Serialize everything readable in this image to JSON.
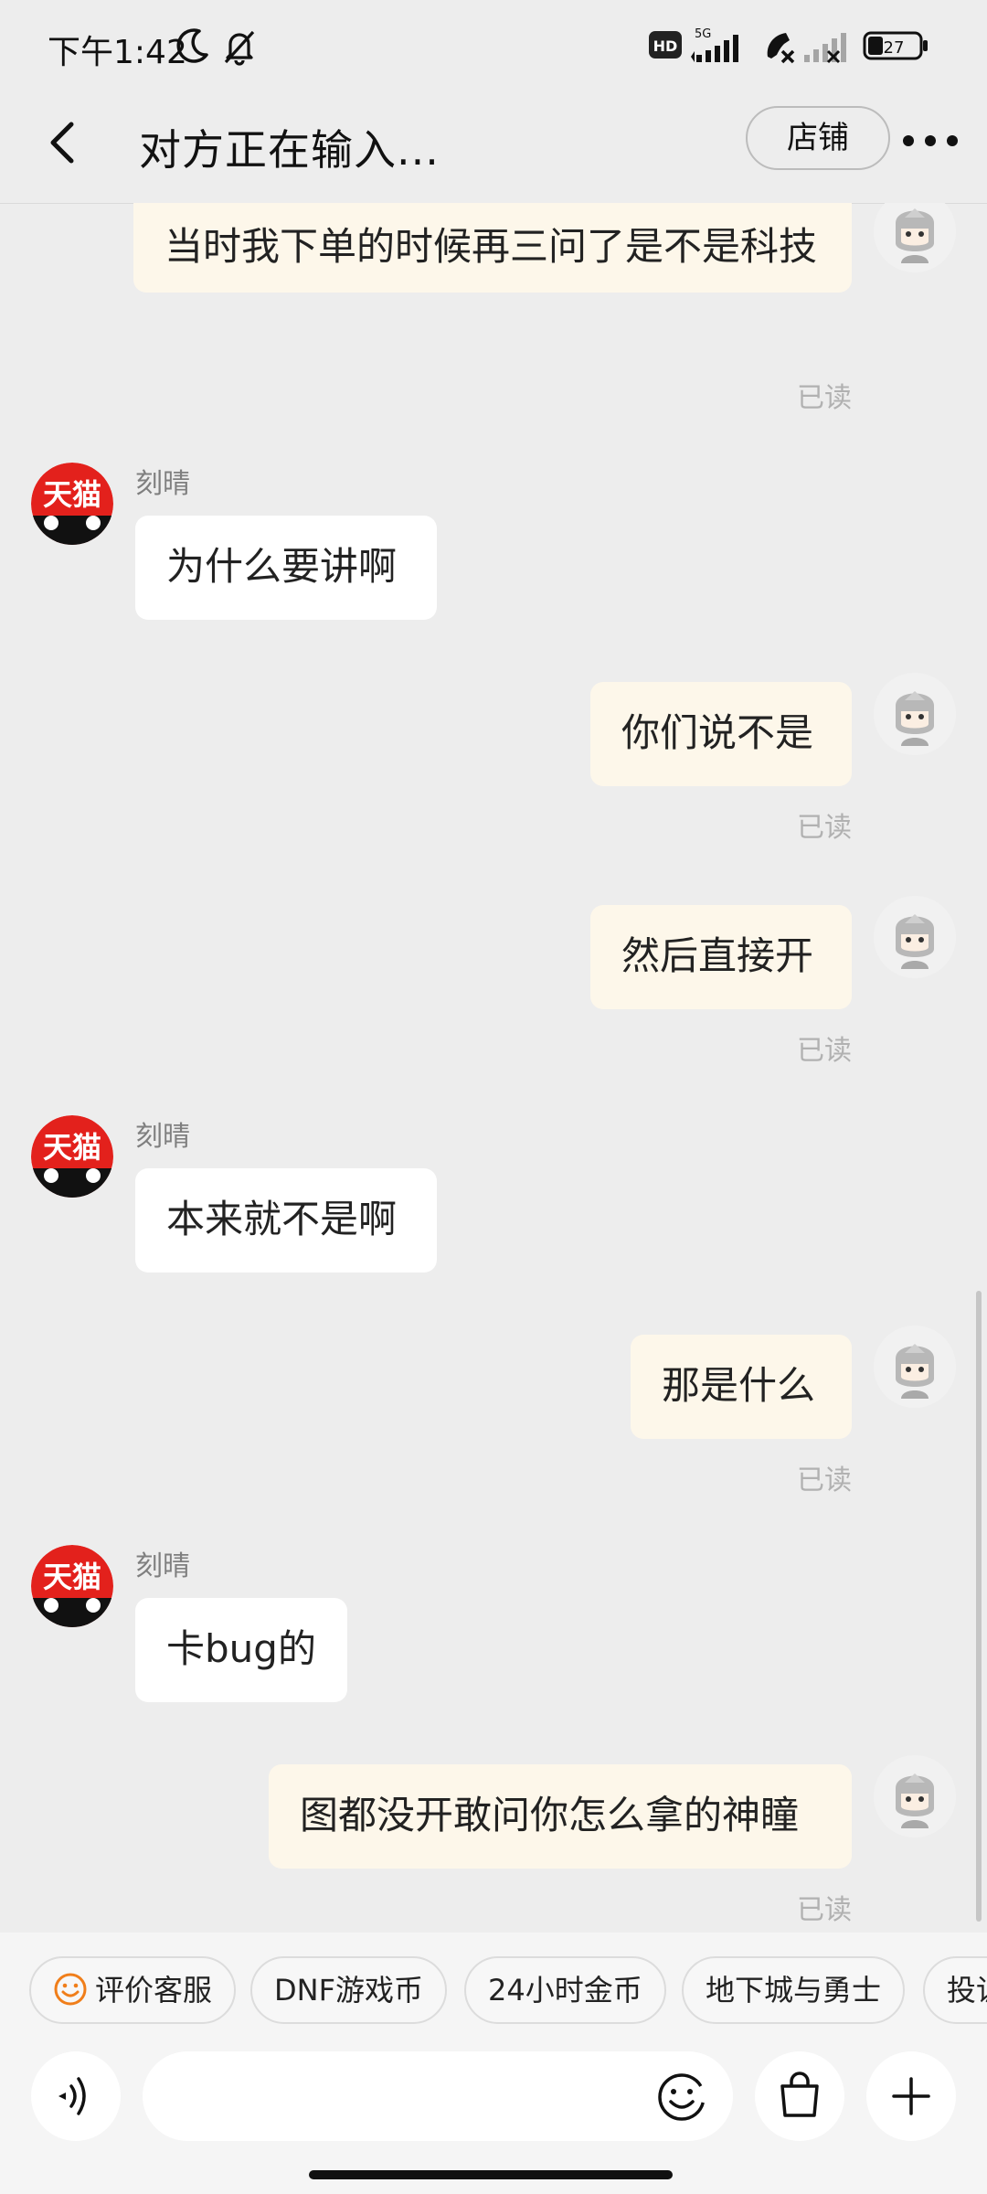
{
  "status_bar": {
    "time": "下午1:42",
    "battery": "27",
    "network": "5G",
    "hd_badge": "HD",
    "icons": [
      "moon-icon",
      "bell-off-icon",
      "hd-icon",
      "signal-5g-icon",
      "call-icon",
      "signal-weak-icon",
      "battery-icon"
    ]
  },
  "header": {
    "title": "对方正在输入...",
    "shop_button": "店铺",
    "icons": [
      "back-icon",
      "more-icon"
    ]
  },
  "messages": [
    {
      "direction": "out",
      "text": "当时我下单的时候再三问了是不是科技",
      "read": "已读"
    },
    {
      "direction": "in",
      "sender": "刻晴",
      "avatar_label": "天猫",
      "text": "为什么要讲啊"
    },
    {
      "direction": "out",
      "text": "你们说不是",
      "read": "已读"
    },
    {
      "direction": "out",
      "text": "然后直接开",
      "read": "已读"
    },
    {
      "direction": "in",
      "sender": "刻晴",
      "avatar_label": "天猫",
      "text": "本来就不是啊"
    },
    {
      "direction": "out",
      "text": "那是什么",
      "read": "已读"
    },
    {
      "direction": "in",
      "sender": "刻晴",
      "avatar_label": "天猫",
      "text": "卡bug的"
    },
    {
      "direction": "out",
      "text": "图都没开敢问你怎么拿的神瞳",
      "read": "已读"
    }
  ],
  "quick_actions": [
    {
      "label": "评价客服",
      "icon": "smile-icon"
    },
    {
      "label": "DNF游戏币"
    },
    {
      "label": "24小时金币"
    },
    {
      "label": "地下城与勇士"
    },
    {
      "label": "投诉"
    }
  ],
  "input_bar": {
    "placeholder": "",
    "icons": [
      "voice-icon",
      "emoji-icon",
      "shopping-bag-icon",
      "plus-icon"
    ]
  },
  "colors": {
    "background": "#ededed",
    "outgoing_bubble": "#fdf7ea",
    "incoming_bubble": "#ffffff",
    "tmall_red": "#e3211c",
    "read_text": "#b1b1b1",
    "chip_icon": "#f07e1a"
  }
}
